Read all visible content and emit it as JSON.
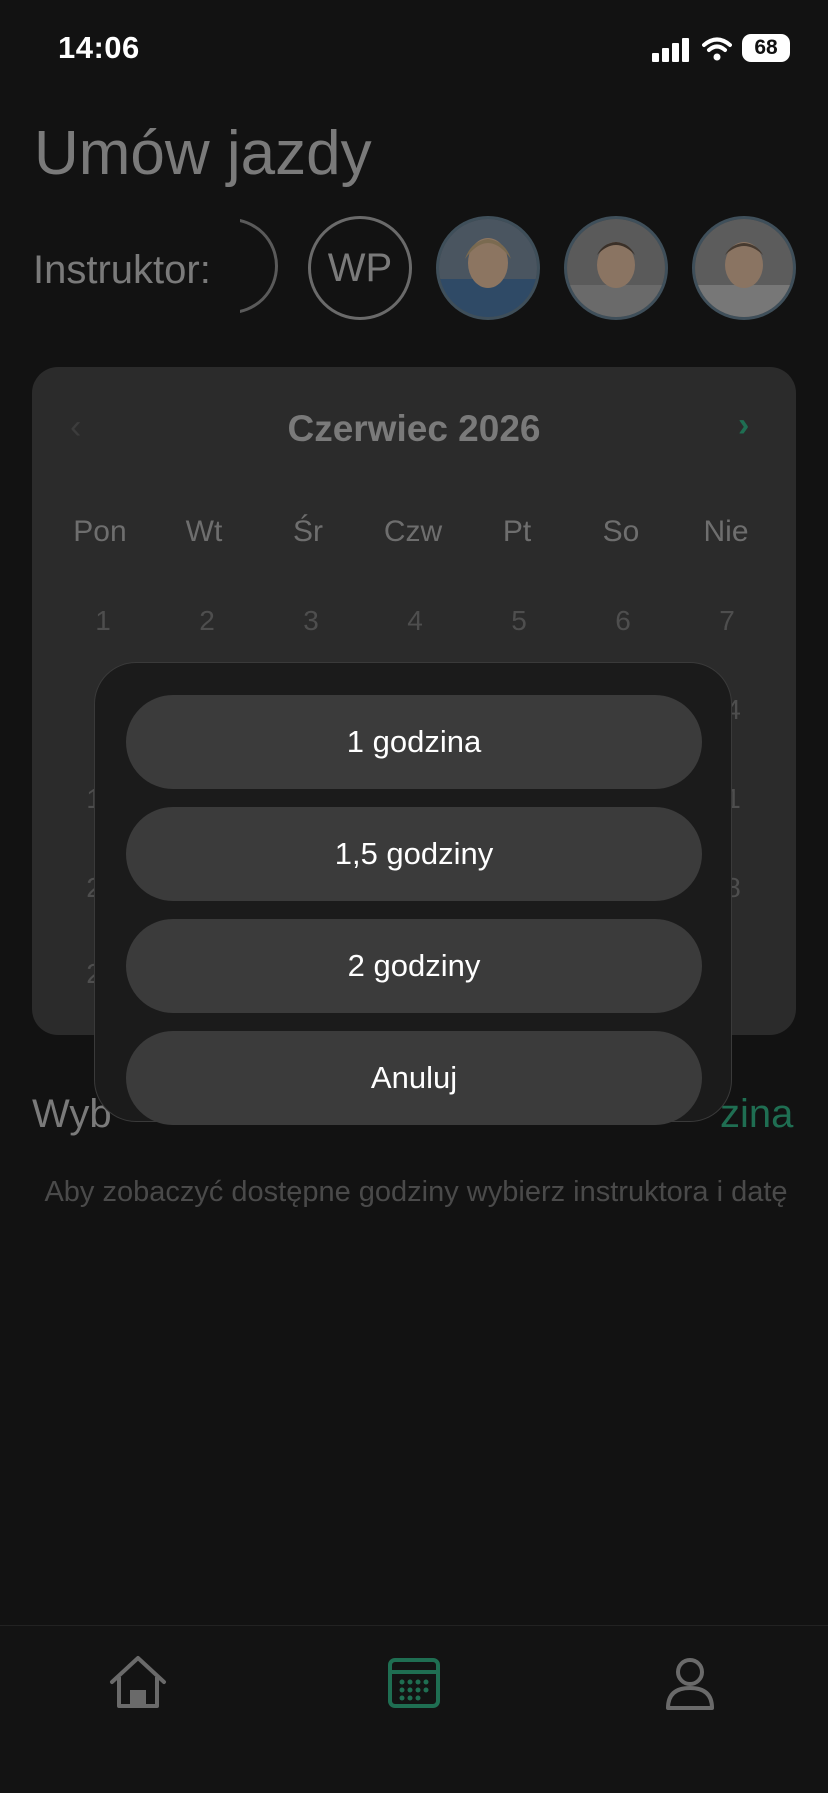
{
  "status_bar": {
    "time": "14:06",
    "battery": "68"
  },
  "title": "Umów jazdy",
  "instructor_label": "Instruktor:",
  "instructors": [
    {
      "initials": "WP"
    }
  ],
  "calendar": {
    "month": "Czerwiec 2026",
    "weekdays": [
      "Pon",
      "Wt",
      "Śr",
      "Czw",
      "Pt",
      "So",
      "Nie"
    ],
    "visible_days": {
      "row1": [
        "1",
        "2",
        "3",
        "4",
        "5",
        "6",
        "7"
      ],
      "row2_last": "4",
      "row3_first": "1",
      "row3_last": "1",
      "row4_first": "2",
      "row4_last": "8",
      "row5_first": "2"
    }
  },
  "selection": {
    "left_text": "Wyb",
    "right_text": "zina"
  },
  "hint": "Aby zobaczyć dostępne godziny wybierz instruktora i datę",
  "sheet": {
    "options": [
      "1 godzina",
      "1,5 godziny",
      "2 godziny"
    ],
    "cancel": "Anuluj"
  },
  "colors": {
    "accent": "#1f6e52",
    "background": "#121212"
  }
}
